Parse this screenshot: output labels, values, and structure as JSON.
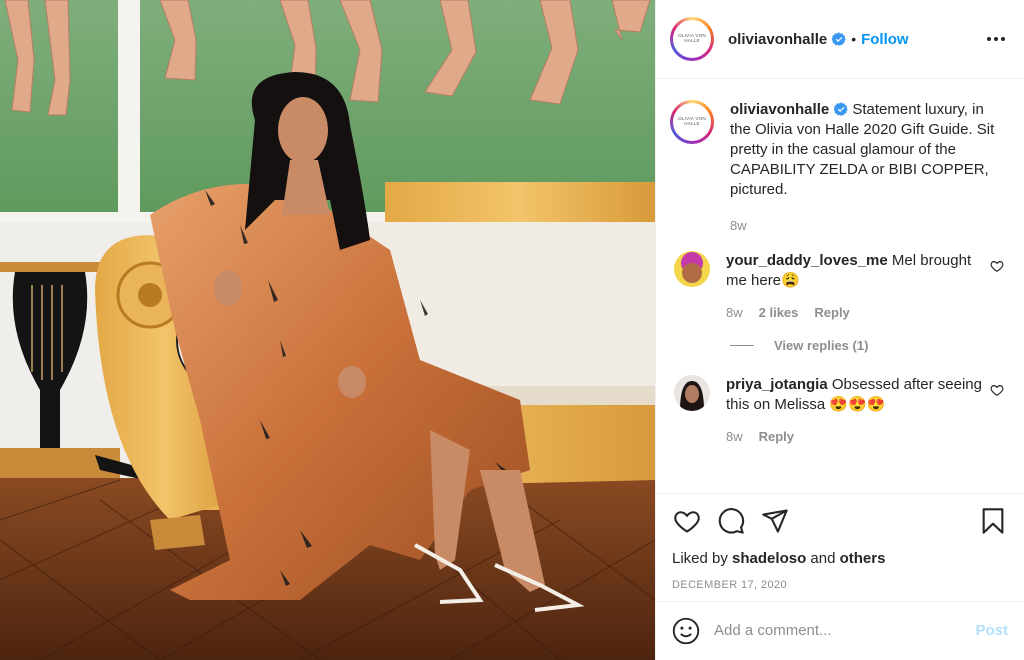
{
  "post": {
    "image_alt": "Woman in copper satin slip dress and zebra-print robe seated on a cream daybed",
    "account": {
      "username": "oliviavonhalle",
      "avatar_text": "OLIVIA VON HALLE",
      "follow_label": "Follow",
      "separator": "•"
    },
    "caption": {
      "username": "oliviavonhalle",
      "text": " Statement luxury, in the Olivia von Halle 2020 Gift Guide. Sit pretty in the casual glamour of the CAPABILITY ZELDA or BIBI COPPER, pictured.",
      "age": "8w"
    },
    "comments": [
      {
        "username": "your_daddy_loves_me",
        "text": " Mel brought me here😩",
        "age": "8w",
        "likes": "2 likes",
        "reply_label": "Reply",
        "view_replies": "View replies (1)"
      },
      {
        "username": "priya_jotangia",
        "text": " Obsessed after seeing this on Melissa 😍😍😍",
        "age": "8w",
        "reply_label": "Reply"
      }
    ],
    "liked_by": {
      "prefix": "Liked by ",
      "user": "shadeloso",
      "middle": " and ",
      "others": "others"
    },
    "date": "DECEMBER 17, 2020",
    "add_comment": {
      "placeholder": "Add a comment...",
      "post_label": "Post"
    },
    "colors": {
      "accent": "#0095f6",
      "post_disabled": "#b2dffc",
      "muted": "#8e8e8e",
      "text": "#262626"
    }
  }
}
